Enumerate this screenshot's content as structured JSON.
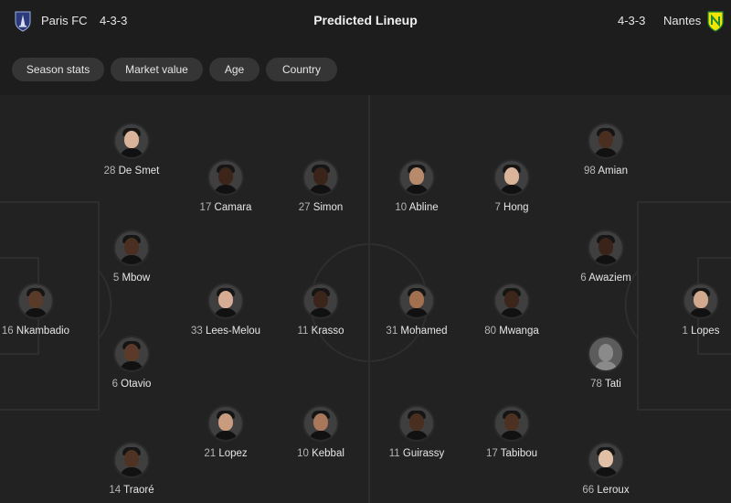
{
  "header": {
    "title": "Predicted Lineup",
    "home": {
      "name": "Paris FC",
      "formation": "4-3-3",
      "crest_icon": "paris-fc-crest-icon",
      "crest_color": "#2a3a7a"
    },
    "away": {
      "name": "Nantes",
      "formation": "4-3-3",
      "crest_icon": "nantes-crest-icon",
      "crest_color": "#f2e500"
    }
  },
  "tabs": [
    {
      "label": "Season stats"
    },
    {
      "label": "Market value"
    },
    {
      "label": "Age"
    },
    {
      "label": "Country"
    }
  ],
  "home_players": [
    {
      "number": "16",
      "name": "Nkambadio",
      "skin": "#5a3a28"
    },
    {
      "number": "28",
      "name": "De Smet",
      "skin": "#d8b39a"
    },
    {
      "number": "5",
      "name": "Mbow",
      "skin": "#4a2f22"
    },
    {
      "number": "6",
      "name": "Otavio",
      "skin": "#5b3a2a"
    },
    {
      "number": "14",
      "name": "Traoré",
      "skin": "#4e3224"
    },
    {
      "number": "17",
      "name": "Camara",
      "skin": "#3d2519"
    },
    {
      "number": "33",
      "name": "Lees-Melou",
      "skin": "#d6ad94"
    },
    {
      "number": "21",
      "name": "Lopez",
      "skin": "#c99c80"
    },
    {
      "number": "27",
      "name": "Simon",
      "skin": "#3a241a"
    },
    {
      "number": "11",
      "name": "Krasso",
      "skin": "#3b251b"
    },
    {
      "number": "10",
      "name": "Kebbal",
      "skin": "#a9775a"
    }
  ],
  "away_players": [
    {
      "number": "10",
      "name": "Abline",
      "skin": "#b88a6c"
    },
    {
      "number": "31",
      "name": "Mohamed",
      "skin": "#a2704f"
    },
    {
      "number": "11",
      "name": "Guirassy",
      "skin": "#4a2e20"
    },
    {
      "number": "7",
      "name": "Hong",
      "skin": "#dbb59a"
    },
    {
      "number": "80",
      "name": "Mwanga",
      "skin": "#3c261b"
    },
    {
      "number": "17",
      "name": "Tabibou",
      "skin": "#4d3123"
    },
    {
      "number": "98",
      "name": "Amian",
      "skin": "#4a2f21"
    },
    {
      "number": "6",
      "name": "Awaziem",
      "skin": "#3a2419"
    },
    {
      "number": "78",
      "name": "Tati",
      "skin": "",
      "placeholder": true
    },
    {
      "number": "66",
      "name": "Leroux",
      "skin": "#e2c0a6"
    },
    {
      "number": "1",
      "name": "Lopes",
      "skin": "#d2a98c"
    }
  ]
}
